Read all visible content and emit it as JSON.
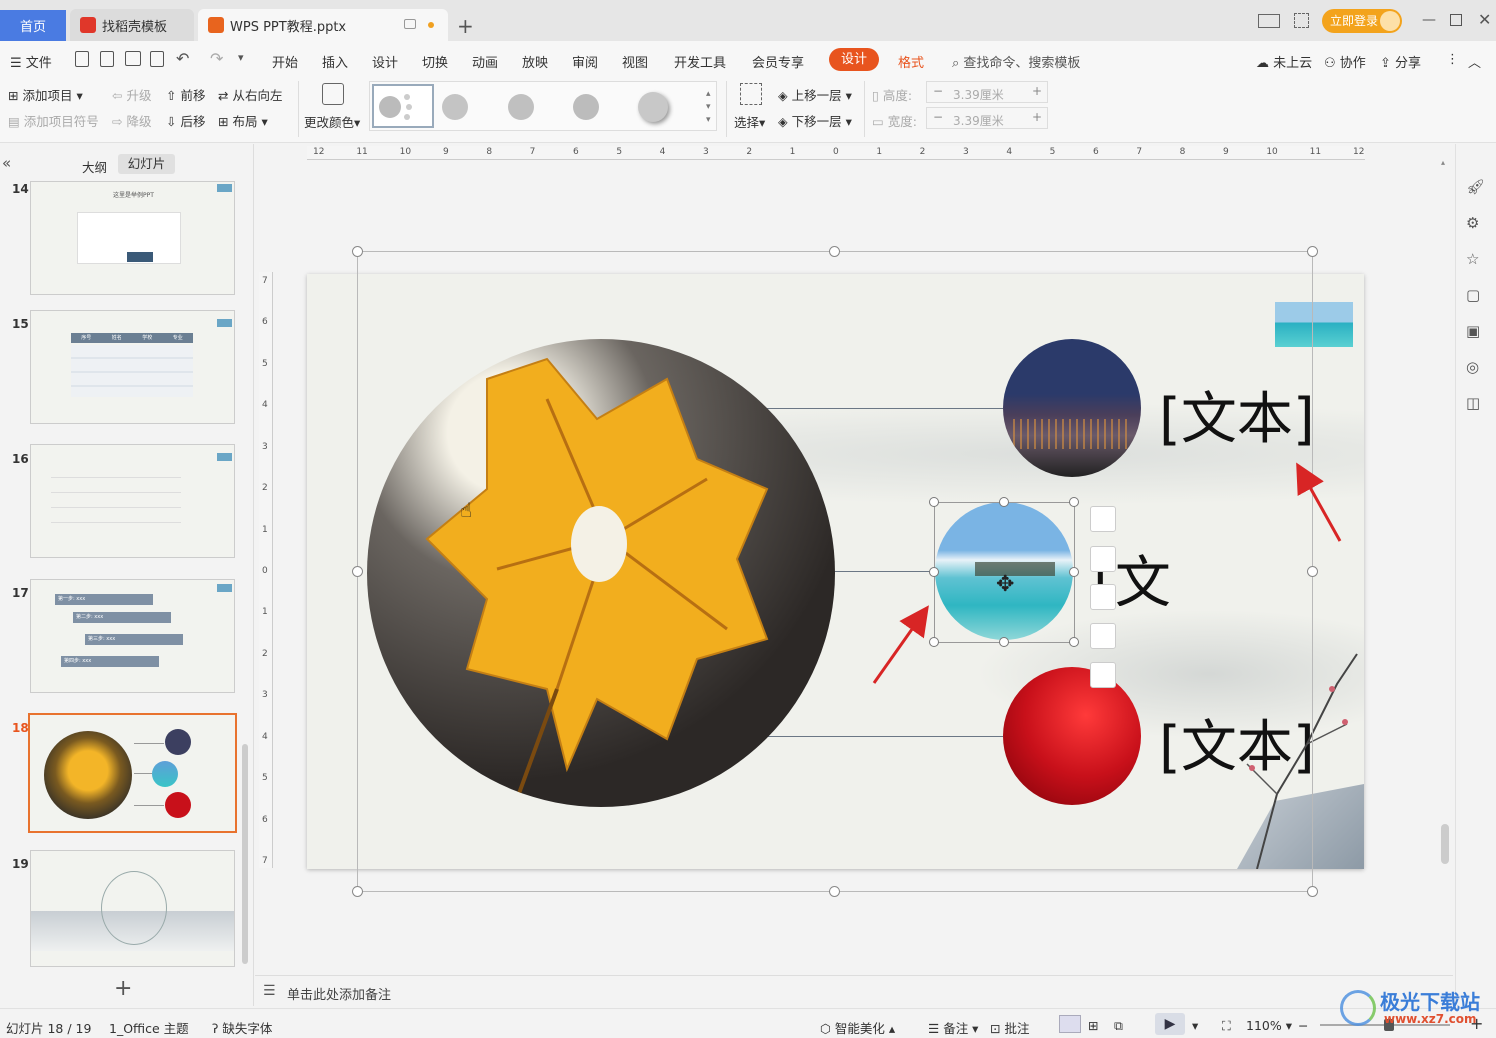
{
  "tabs": {
    "home": "首页",
    "templates": "找稻壳模板",
    "doc": "WPS PPT教程.pptx",
    "login": "立即登录"
  },
  "menu": {
    "file": "文件",
    "items": [
      "开始",
      "插入",
      "设计",
      "切换",
      "动画",
      "放映",
      "审阅",
      "视图",
      "开发工具",
      "会员专享"
    ],
    "design_active": "设计",
    "format": "格式",
    "search": "查找命令、搜索模板",
    "cloud": "未上云",
    "collab": "协作",
    "share": "分享"
  },
  "ribbon": {
    "add_item": "添加项目",
    "add_bullet": "添加项目符号",
    "upgrade": "升级",
    "downgrade": "降级",
    "forward": "前移",
    "backward": "后移",
    "rtl": "从右向左",
    "layout": "布局",
    "change_color": "更改颜色",
    "select": "选择",
    "bring_forward": "上移一层",
    "send_backward": "下移一层",
    "height_label": "高度:",
    "width_label": "宽度:",
    "height_value": "3.39厘米",
    "width_value": "3.39厘米"
  },
  "panel": {
    "outline": "大纲",
    "slides": "幻灯片",
    "slide_numbers": [
      "14",
      "15",
      "16",
      "17",
      "18",
      "19"
    ],
    "slide14_title": "这里是举例PPT",
    "slide15_headers": [
      "序号",
      "姓名",
      "学校",
      "专业"
    ],
    "slide17_steps": [
      "第一步: xxx",
      "第二步: xxx",
      "第三步: xxx",
      "第四步: xxx"
    ]
  },
  "slide": {
    "text1": "[文本]",
    "text2": "[文本]",
    "text3": "[文本]"
  },
  "notes_placeholder": "单击此处添加备注",
  "status": {
    "slide_pos": "幻灯片 18 / 19",
    "theme": "1_Office 主题",
    "missing_font": "缺失字体",
    "beautify": "智能美化",
    "notes": "备注",
    "comment": "批注",
    "zoom": "110%"
  },
  "watermark": {
    "name": "极光下载站",
    "url": "www.xz7.com"
  },
  "ruler": {
    "h_labels": [
      "12",
      "11",
      "10",
      "9",
      "8",
      "7",
      "6",
      "5",
      "4",
      "3",
      "2",
      "1",
      "0",
      "1",
      "2",
      "3",
      "4",
      "5",
      "6",
      "7",
      "8",
      "9",
      "10",
      "11",
      "12"
    ],
    "v_labels": [
      "7",
      "6",
      "5",
      "4",
      "3",
      "2",
      "1",
      "0",
      "1",
      "2",
      "3",
      "4",
      "5",
      "6",
      "7"
    ]
  },
  "colors": {
    "accent": "#e8541e",
    "tab_home": "#4a7be2",
    "login": "#f3a31c",
    "arrow": "#d82525"
  }
}
